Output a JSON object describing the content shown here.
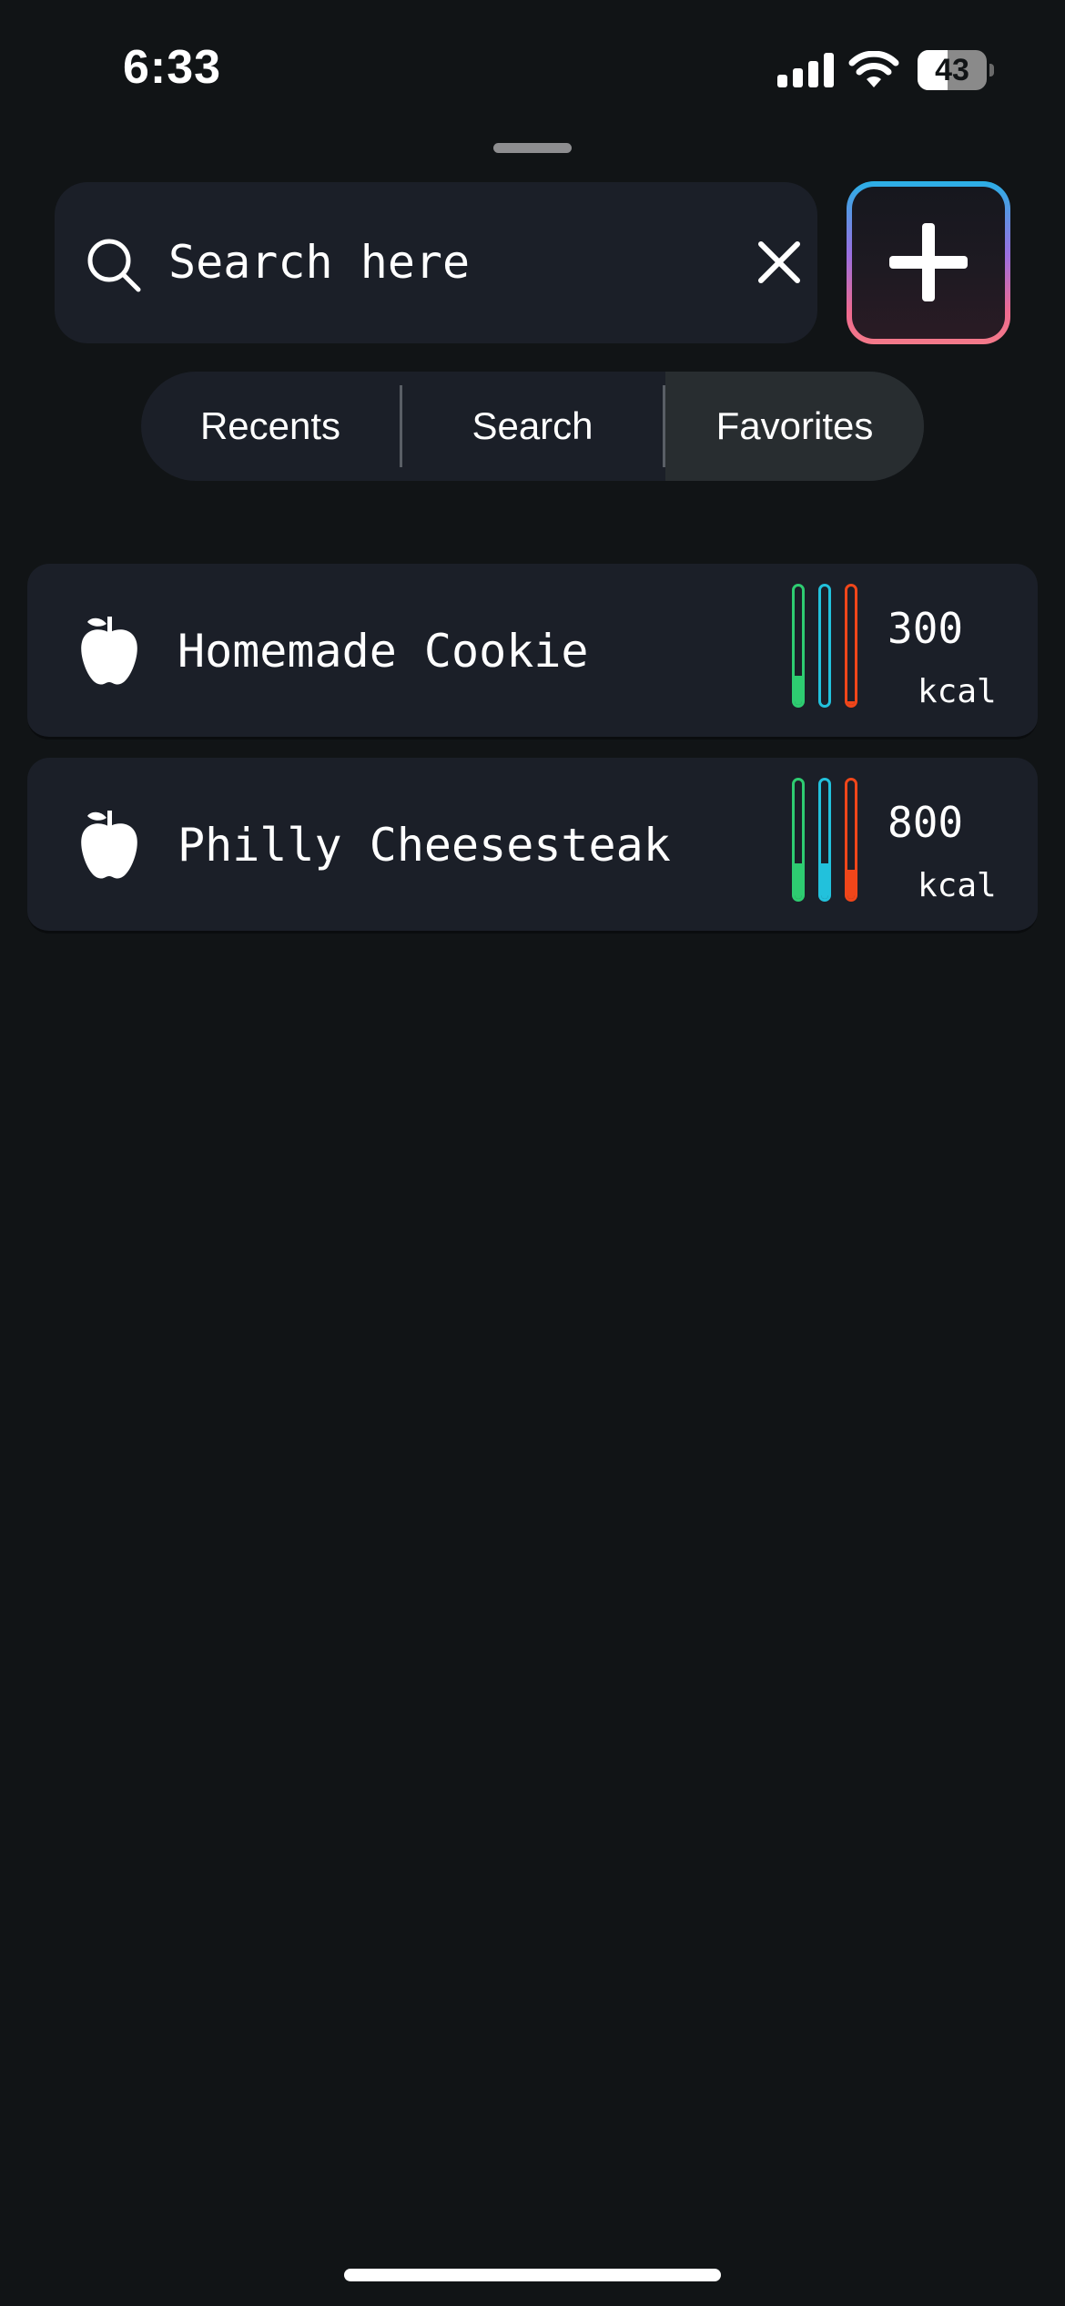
{
  "status_bar": {
    "time": "6:33",
    "battery_level": "43",
    "battery_percent": 43,
    "signal_bars": 4,
    "icons": [
      "signal-icon",
      "wifi-icon",
      "battery-icon"
    ]
  },
  "search": {
    "placeholder": "Search here",
    "value": "",
    "icon": "search-icon",
    "clear_icon": "close-icon"
  },
  "add_button": {
    "icon": "plus-icon",
    "gradient_colors": [
      "#2ab0e6",
      "#9b6fe0",
      "#f47a8a"
    ]
  },
  "tabs": [
    {
      "label": "Recents",
      "active": false
    },
    {
      "label": "Search",
      "active": false
    },
    {
      "label": "Favorites",
      "active": true
    }
  ],
  "colors": {
    "background": "#111416",
    "card": "#1b1f28",
    "macro_green": "#2ecc71",
    "macro_cyan": "#22c1dc",
    "macro_orange": "#f0461a"
  },
  "foods": [
    {
      "name": "Homemade Cookie",
      "icon": "apple-icon",
      "kcal": "300",
      "unit": "kcal",
      "macros": [
        {
          "nutrient": "green",
          "color": "#2ecc71",
          "fill_percent": 25
        },
        {
          "nutrient": "cyan",
          "color": "#22c1dc",
          "fill_percent": 0
        },
        {
          "nutrient": "orange",
          "color": "#f0461a",
          "fill_percent": 3
        }
      ]
    },
    {
      "name": "Philly Cheesesteak",
      "icon": "apple-icon",
      "kcal": "800",
      "unit": "kcal",
      "macros": [
        {
          "nutrient": "green",
          "color": "#2ecc71",
          "fill_percent": 30
        },
        {
          "nutrient": "cyan",
          "color": "#22c1dc",
          "fill_percent": 30
        },
        {
          "nutrient": "orange",
          "color": "#f0461a",
          "fill_percent": 25
        }
      ]
    }
  ]
}
